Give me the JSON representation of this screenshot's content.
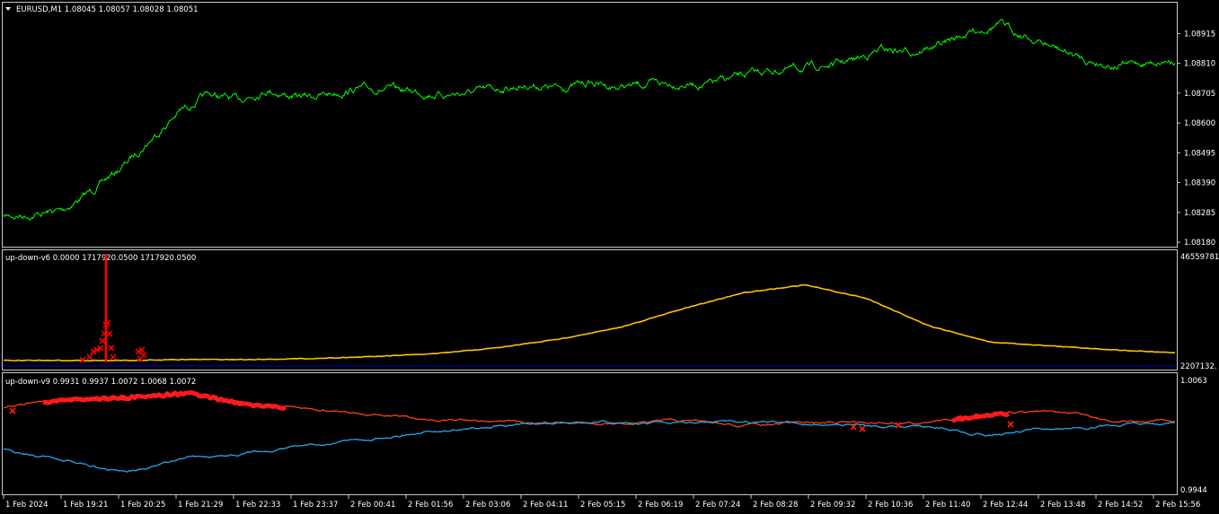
{
  "window": {
    "symbol_header": "EURUSD,M1  1.08045 1.08057 1.08028 1.08051"
  },
  "chart_data": [
    {
      "type": "line",
      "title": "EURUSD,M1  1.08045 1.08057 1.08028 1.08051",
      "ylim": [
        1.0818,
        1.0897
      ],
      "yticks": [
        "1.08915",
        "1.08810",
        "1.08705",
        "1.08600",
        "1.08495",
        "1.08390",
        "1.08285",
        "1.08180"
      ],
      "color": "#00ff00",
      "series": [
        {
          "values": [
            1.0827,
            1.08278,
            1.08292,
            1.0836,
            1.0844,
            1.0854,
            1.0864,
            1.087,
            1.0868,
            1.0872,
            1.0869,
            1.087,
            1.0872,
            1.08718,
            1.08712,
            1.087,
            1.08708,
            1.08722,
            1.08735,
            1.08722,
            1.08742,
            1.08726,
            1.08736,
            1.0874,
            1.08735,
            1.0876,
            1.08782,
            1.0879,
            1.088,
            1.0882,
            1.0886,
            1.08852,
            1.08875,
            1.0892,
            1.0895,
            1.089,
            1.0886,
            1.0882,
            1.08803,
            1.08812,
            1.08824
          ]
        }
      ]
    },
    {
      "type": "line",
      "title": "up-down-v6 0.0000 1717920.0500  1717920.0500",
      "ylim": [
        0,
        46559781
      ],
      "yticks": [
        "46559781.",
        "2207132."
      ],
      "legend_color": {
        "signal": "#ff0000",
        "line": "#ffc000",
        "base": "#0000cc"
      },
      "series": [
        {
          "name": "",
          "values": [
            0.02,
            0.02,
            0.02,
            0.03,
            0.03,
            0.04,
            0.06,
            0.09,
            0.15,
            0.24,
            0.36,
            0.55,
            0.72,
            0.8,
            0.66,
            0.38,
            0.21,
            0.17,
            0.13,
            0.1
          ]
        }
      ],
      "spike_value": 1717920.05
    },
    {
      "type": "line",
      "title": "up-down-v9 0.9931 0.9937 1.0072 1.0068 1.0072",
      "ylim": [
        0.9944,
        1.0063
      ],
      "yticks": [
        "1.0063",
        "0.9944"
      ],
      "series": [
        {
          "name": "",
          "color": "#ff4010",
          "values": [
            1.0034,
            1.0042,
            1.0044,
            1.0049,
            1.0036,
            1.0031,
            1.0027,
            1.0021,
            1.0018,
            1.0016,
            1.0017,
            1.0018,
            1.0014,
            1.0016,
            1.0018,
            1.0017,
            1.0025,
            1.003,
            1.0018,
            1.0018
          ]
        },
        {
          "name": "",
          "color": "#20a8f0",
          "values": [
            0.9988,
            0.9975,
            0.9962,
            0.998,
            0.9985,
            0.9994,
            1.0,
            1.0009,
            1.0013,
            1.0016,
            1.0017,
            1.0016,
            1.0017,
            1.0016,
            1.0014,
            1.0013,
            1.0004,
            1.001,
            1.0014,
            1.0016
          ]
        }
      ]
    }
  ],
  "xaxis": {
    "labels": [
      "1 Feb 2024",
      "1 Feb 19:21",
      "1 Feb 20:25",
      "1 Feb 21:29",
      "1 Feb 22:33",
      "1 Feb 23:37",
      "2 Feb 00:41",
      "2 Feb 01:56",
      "2 Feb 03:06",
      "2 Feb 04:11",
      "2 Feb 05:15",
      "2 Feb 06:19",
      "2 Feb 07:24",
      "2 Feb 08:28",
      "2 Feb 09:32",
      "2 Feb 10:36",
      "2 Feb 11:40",
      "2 Feb 12:44",
      "2 Feb 13:48",
      "2 Feb 14:52",
      "2 Feb 15:56"
    ]
  }
}
